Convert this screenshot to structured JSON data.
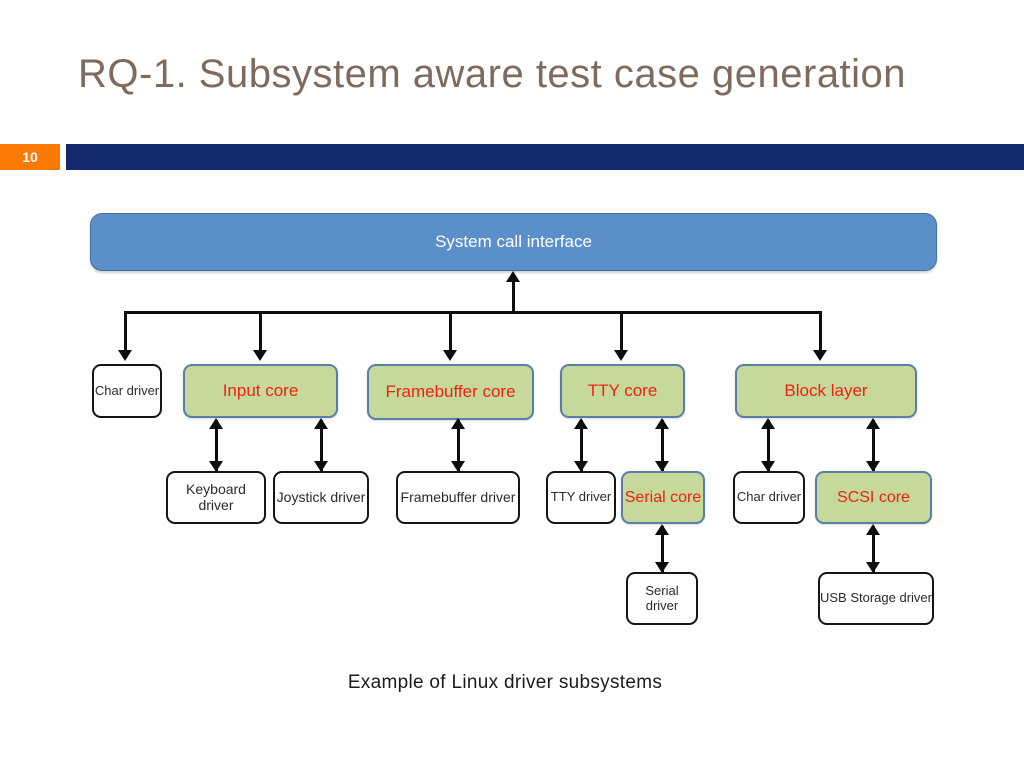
{
  "slide": {
    "title": "RQ-1. Subsystem aware test case generation",
    "page_number": "10",
    "caption": "Example of Linux driver subsystems",
    "colors": {
      "title_text": "#7f6b5d",
      "badge_background": "#fa7a05",
      "header_bar": "#122a6b",
      "banner_fill": "#5b8fca",
      "core_fill": "#c6d99a",
      "core_text": "#ee2211",
      "driver_fill": "#ffffff",
      "line": "#0d0d0d"
    }
  },
  "diagram": {
    "banner": {
      "label": "System call interface"
    },
    "subsystems": [
      {
        "label": "Char driver",
        "kind": "driver"
      },
      {
        "label": "Input core",
        "kind": "core"
      },
      {
        "label": "Framebuffer core",
        "kind": "core"
      },
      {
        "label": "TTY core",
        "kind": "core"
      },
      {
        "label": "Block layer",
        "kind": "core"
      }
    ],
    "drivers": [
      {
        "label": "Keyboard driver",
        "kind": "driver"
      },
      {
        "label": "Joystick driver",
        "kind": "driver"
      },
      {
        "label": "Framebuffer driver",
        "kind": "driver"
      },
      {
        "label": "TTY driver",
        "kind": "driver"
      },
      {
        "label": "Serial core",
        "kind": "core"
      },
      {
        "label": "Char driver",
        "kind": "driver"
      },
      {
        "label": "SCSI core",
        "kind": "core"
      }
    ],
    "leaves": [
      {
        "label": "Serial driver",
        "kind": "driver"
      },
      {
        "label": "USB Storage driver",
        "kind": "driver"
      }
    ]
  }
}
